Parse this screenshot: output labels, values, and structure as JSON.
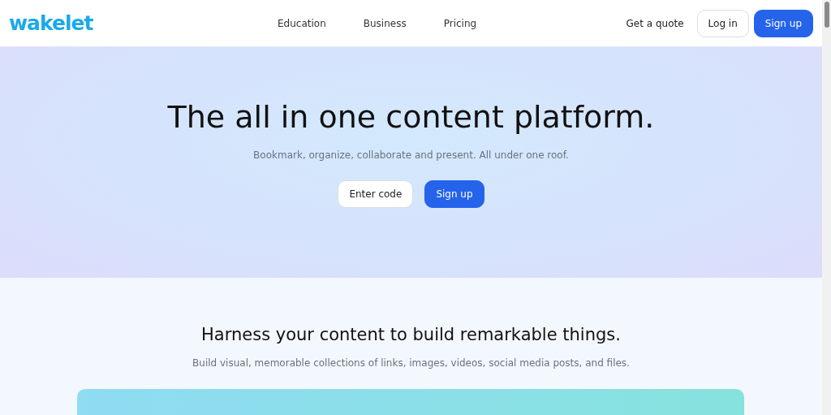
{
  "header": {
    "logo": "wakelet",
    "nav": [
      "Education",
      "Business",
      "Pricing"
    ],
    "quote_link": "Get a quote",
    "login_button": "Log in",
    "signup_button": "Sign up"
  },
  "hero": {
    "title": "The all in one content platform.",
    "subtitle": "Bookmark, organize, collaborate and present. All under one roof.",
    "code_button": "Enter code",
    "signup_button": "Sign up"
  },
  "features": {
    "title": "Harness your content to build remarkable things.",
    "subtitle": "Build visual, memorable collections of links, images, videos, social media posts, and files."
  }
}
